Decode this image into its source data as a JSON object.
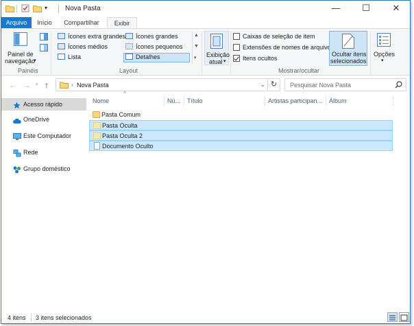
{
  "window": {
    "title": "Nova Pasta",
    "minimize": "—",
    "maximize": "☐",
    "close": "✕"
  },
  "tabs": [
    "Arquivo",
    "Início",
    "Compartilhar",
    "Exibir"
  ],
  "ribbon": {
    "panes": {
      "button": "Painel de",
      "button2": "navegação",
      "group": "Painéis"
    },
    "layout": {
      "items": [
        "Ícones extra grandes",
        "Ícones grandes",
        "Ícones médios",
        "Ícones pequenos",
        "Lista",
        "Detalhes"
      ],
      "selected": "Detalhes",
      "group": "Layout"
    },
    "current_view": {
      "label1": "Exibição",
      "label2": "atual"
    },
    "show_hide": {
      "checkboxes": [
        {
          "label": "Caixas de seleção de item",
          "checked": false
        },
        {
          "label": "Extensões de nomes de arquivos",
          "checked": false
        },
        {
          "label": "Itens ocultos",
          "checked": true
        }
      ],
      "hide_button1": "Ocultar itens",
      "hide_button2": "selecionados",
      "group": "Mostrar/ocultar"
    },
    "options": "Opções"
  },
  "address": {
    "path": "Nova Pasta",
    "search_placeholder": "Pesquisar Nova Pasta"
  },
  "nav_pane": [
    "Acesso rápido",
    "OneDrive",
    "Este Computador",
    "Rede",
    "Grupo doméstico"
  ],
  "columns": [
    "Nome",
    "Nú...",
    "Título",
    "Artistas participan...",
    "Álbum"
  ],
  "files": [
    {
      "name": "Pasta Comum",
      "type": "folder",
      "hidden": false,
      "selected": false
    },
    {
      "name": "Pasta Oculta",
      "type": "folder",
      "hidden": true,
      "selected": true
    },
    {
      "name": "Pasta Oculta 2",
      "type": "folder",
      "hidden": true,
      "selected": true
    },
    {
      "name": "Documento Oculto",
      "type": "document",
      "hidden": true,
      "selected": true
    }
  ],
  "status": {
    "count": "4 itens",
    "selected": "3 itens selecionados"
  },
  "colors": {
    "accent": "#1979ca",
    "selection": "#cce8ff",
    "selection_border": "#99d1ff"
  }
}
